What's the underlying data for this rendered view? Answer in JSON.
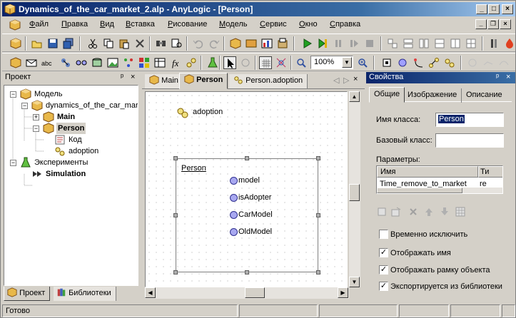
{
  "window": {
    "title": "Dynamics_of_the_car_market_2.alp - AnyLogic - [Person]"
  },
  "menu": [
    "Файл",
    "Правка",
    "Вид",
    "Вставка",
    "Рисование",
    "Модель",
    "Сервис",
    "Окно",
    "Справка"
  ],
  "toolbar": {
    "zoom": "100%"
  },
  "project_panel": {
    "title": "Проект",
    "tree": [
      {
        "label": "Модель"
      },
      {
        "label": "dynamics_of_the_car_mar"
      },
      {
        "label": "Main"
      },
      {
        "label": "Person"
      },
      {
        "label": "Код"
      },
      {
        "label": "adoption"
      },
      {
        "label": "Эксперименты"
      },
      {
        "label": "Simulation"
      }
    ],
    "bottom_tabs": [
      "Проект",
      "Библиотеки"
    ]
  },
  "editor": {
    "tabs": [
      "Main",
      "Person",
      "Person.adoption"
    ],
    "canvas": {
      "statechart_label": "adoption",
      "frame_label": "Person",
      "variables": [
        "model",
        "isAdopter",
        "CarModel",
        "OldModel"
      ]
    }
  },
  "properties": {
    "title": "Свойства",
    "tabs": [
      "Общие",
      "Изображение",
      "Описание"
    ],
    "class_name_label": "Имя класса:",
    "class_name_value": "Person",
    "base_class_label": "Базовый класс:",
    "base_class_value": "",
    "params_label": "Параметры:",
    "params_columns": [
      "Имя",
      "Ти"
    ],
    "params_rows": [
      [
        "Time_remove_to_market",
        "re"
      ]
    ],
    "checkboxes": [
      {
        "label": "Временно исключить",
        "checked": false
      },
      {
        "label": "Отображать имя",
        "checked": true
      },
      {
        "label": "Отображать рамку объекта",
        "checked": true
      },
      {
        "label": "Экспортируется из библиотеки",
        "checked": true
      }
    ]
  },
  "status": {
    "text": "Готово"
  }
}
